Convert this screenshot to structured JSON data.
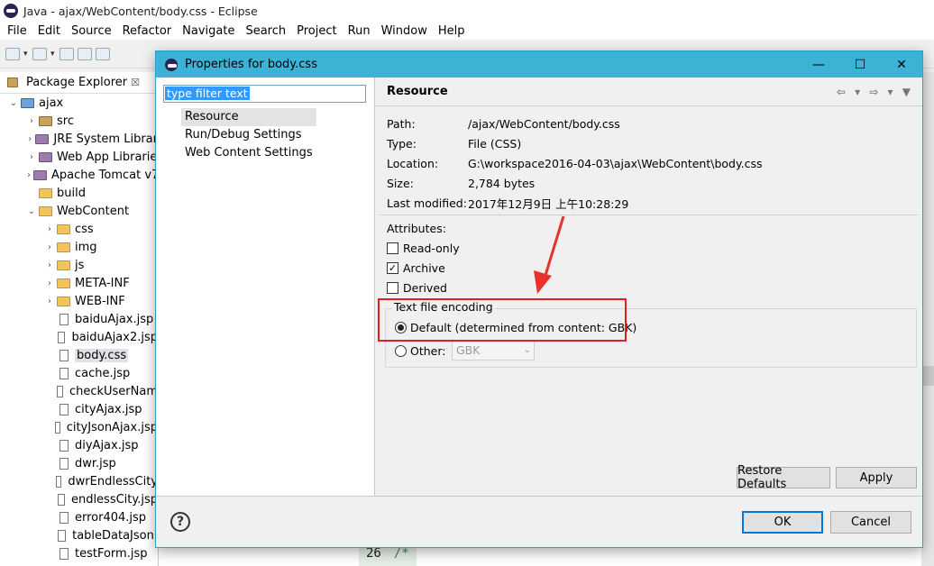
{
  "window": {
    "title": "Java - ajax/WebContent/body.css - Eclipse"
  },
  "menu": [
    "File",
    "Edit",
    "Source",
    "Refactor",
    "Navigate",
    "Search",
    "Project",
    "Run",
    "Window",
    "Help"
  ],
  "explorer": {
    "tab_label": "Package Explorer",
    "close_glyph": "☒",
    "items": [
      {
        "label": "ajax",
        "icon": "proj",
        "depth": 0,
        "tw": "⌄"
      },
      {
        "label": "src",
        "icon": "pkg",
        "depth": 1,
        "tw": "›"
      },
      {
        "label": "JRE System Librar",
        "icon": "lib",
        "depth": 1,
        "tw": "›"
      },
      {
        "label": "Web App Librarie",
        "icon": "lib",
        "depth": 1,
        "tw": "›"
      },
      {
        "label": "Apache Tomcat v7",
        "icon": "lib",
        "depth": 1,
        "tw": "›"
      },
      {
        "label": "build",
        "icon": "folder",
        "depth": 1,
        "tw": ""
      },
      {
        "label": "WebContent",
        "icon": "folder",
        "depth": 1,
        "tw": "⌄"
      },
      {
        "label": "css",
        "icon": "folder",
        "depth": 2,
        "tw": "›"
      },
      {
        "label": "img",
        "icon": "folder",
        "depth": 2,
        "tw": "›"
      },
      {
        "label": "js",
        "icon": "folder",
        "depth": 2,
        "tw": "›"
      },
      {
        "label": "META-INF",
        "icon": "folder",
        "depth": 2,
        "tw": "›"
      },
      {
        "label": "WEB-INF",
        "icon": "folder",
        "depth": 2,
        "tw": "›"
      },
      {
        "label": "baiduAjax.jsp",
        "icon": "file",
        "depth": 2,
        "tw": ""
      },
      {
        "label": "baiduAjax2.jsp",
        "icon": "file",
        "depth": 2,
        "tw": ""
      },
      {
        "label": "body.css",
        "icon": "file",
        "depth": 2,
        "tw": "",
        "selected": true
      },
      {
        "label": "cache.jsp",
        "icon": "file",
        "depth": 2,
        "tw": ""
      },
      {
        "label": "checkUserNam",
        "icon": "file",
        "depth": 2,
        "tw": ""
      },
      {
        "label": "cityAjax.jsp",
        "icon": "file",
        "depth": 2,
        "tw": ""
      },
      {
        "label": "cityJsonAjax.jsp",
        "icon": "file",
        "depth": 2,
        "tw": ""
      },
      {
        "label": "diyAjax.jsp",
        "icon": "file",
        "depth": 2,
        "tw": ""
      },
      {
        "label": "dwr.jsp",
        "icon": "file",
        "depth": 2,
        "tw": ""
      },
      {
        "label": "dwrEndlessCity",
        "icon": "file",
        "depth": 2,
        "tw": ""
      },
      {
        "label": "endlessCity.jsp",
        "icon": "file",
        "depth": 2,
        "tw": ""
      },
      {
        "label": "error404.jsp",
        "icon": "file",
        "depth": 2,
        "tw": ""
      },
      {
        "label": "tableDataJson.",
        "icon": "file",
        "depth": 2,
        "tw": ""
      },
      {
        "label": "testForm.jsp",
        "icon": "file",
        "depth": 2,
        "tw": ""
      }
    ]
  },
  "editor": {
    "line_number": "26",
    "code": "/*"
  },
  "dialog": {
    "title": "Properties for body.css",
    "filter_value": "type filter text",
    "nav": [
      "Resource",
      "Run/Debug Settings",
      "Web Content Settings"
    ],
    "section_title": "Resource",
    "nav_arrows": "⇦ ▾ ⇨ ▾ ▼",
    "info": [
      {
        "k": "Path:",
        "v": "/ajax/WebContent/body.css"
      },
      {
        "k": "Type:",
        "v": "File  (CSS)"
      },
      {
        "k": "Location:",
        "v": "G:\\workspace2016-04-03\\ajax\\WebContent\\body.css"
      },
      {
        "k": "Size:",
        "v": "2,784  bytes"
      },
      {
        "k": "Last modified:",
        "v": "2017年12月9日 上午10:28:29"
      }
    ],
    "attributes_label": "Attributes:",
    "checkboxes": [
      {
        "label": "Read-only",
        "checked": false
      },
      {
        "label": "Archive",
        "checked": true
      },
      {
        "label": "Derived",
        "checked": false
      }
    ],
    "encoding_group": "Text file encoding",
    "radio_default": "Default (determined from content: GBK)",
    "radio_other": "Other:",
    "other_value": "GBK",
    "restore_label": "Restore Defaults",
    "apply_label": "Apply",
    "ok_label": "OK",
    "cancel_label": "Cancel",
    "help_glyph": "?"
  },
  "colors": {
    "title_bar": "#3cb2d5",
    "highlight": "#e02020",
    "selection": "#3399ff"
  }
}
